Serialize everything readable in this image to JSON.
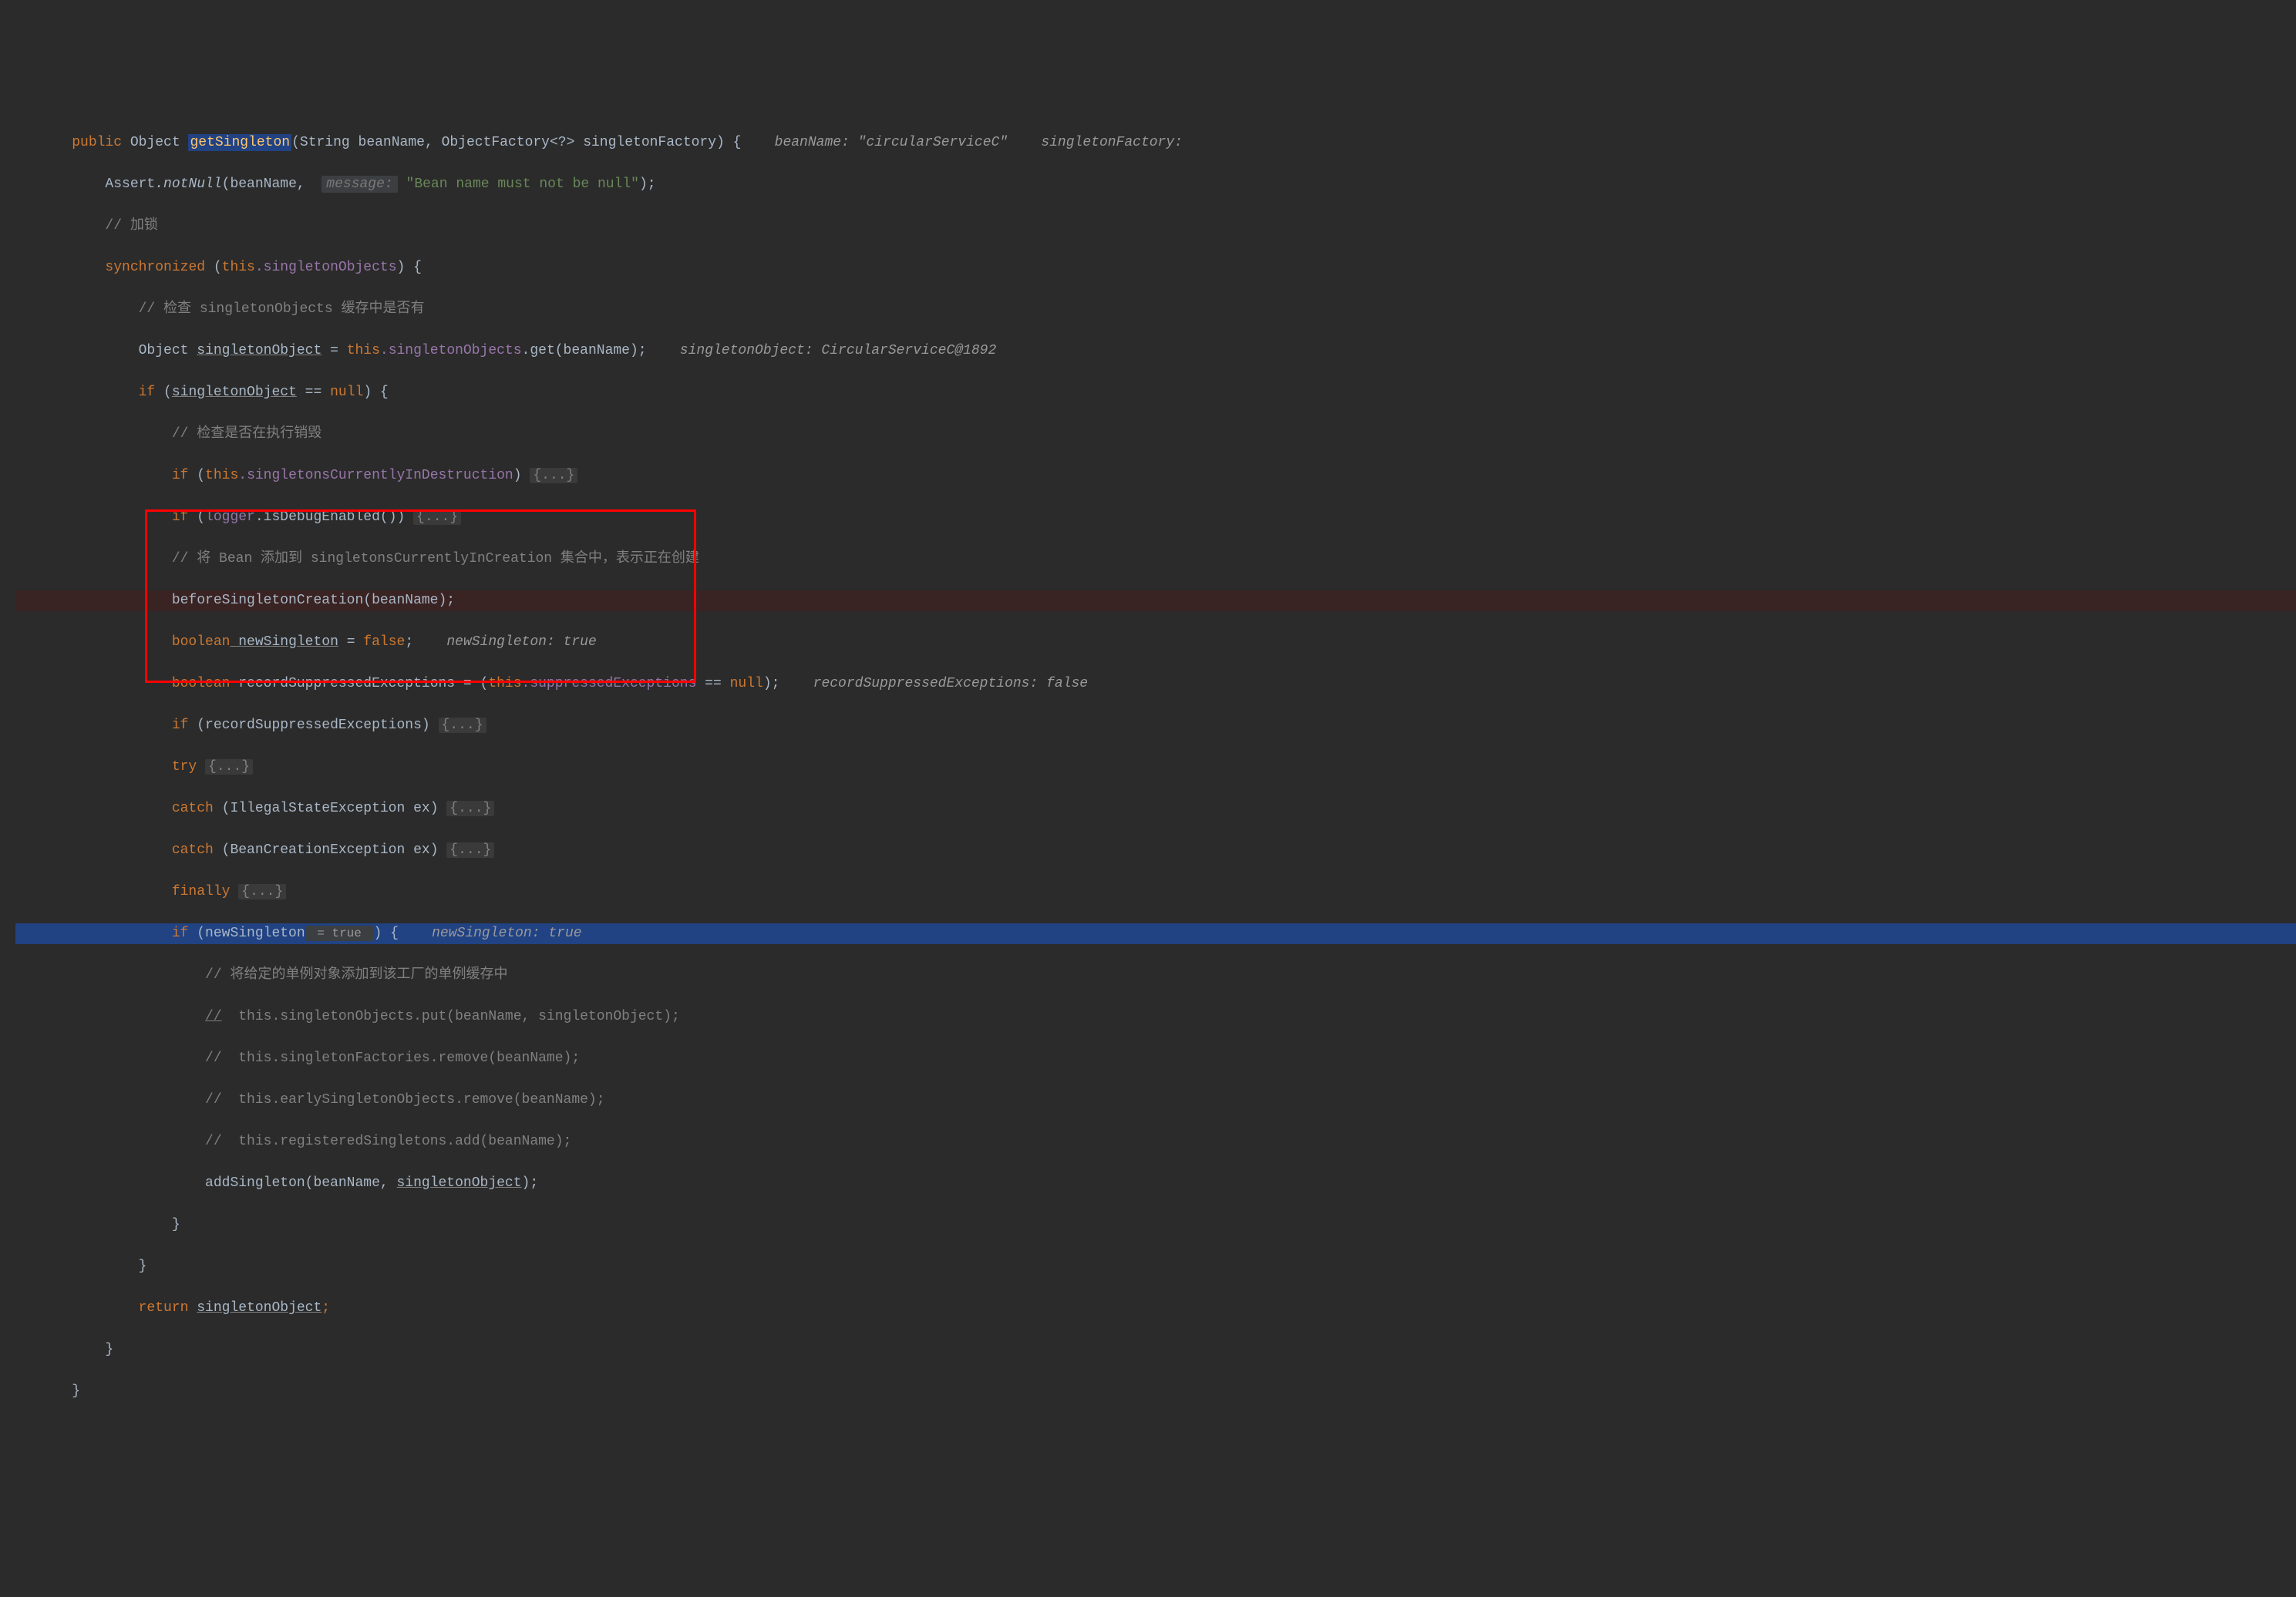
{
  "code": {
    "l1": {
      "kw_public": "public",
      "type_object": "Object",
      "method_name": "getSingleton",
      "param1_type": "String",
      "param1_name": "beanName",
      "param2_type": "ObjectFactory<?>",
      "param2_name": "singletonFactory",
      "brace": ") {",
      "hint_bean": "beanName: \"circularServiceC\"",
      "hint_factory": "singletonFactory:"
    },
    "l2": {
      "assert_cls": "Assert",
      "assert_m": ".notNull",
      "p1": "(beanName,",
      "hint_msg": "message:",
      "str_msg": "\"Bean name must not be null\"",
      "end": ");"
    },
    "l3": {
      "comment": "// 加锁"
    },
    "l4": {
      "kw_sync": "synchronized",
      "open": " (",
      "kw_this": "this",
      "field": ".singletonObjects",
      "close": ") {"
    },
    "l5": {
      "comment": "// 检查 singletonObjects 缓存中是否有"
    },
    "l6": {
      "type": "Object ",
      "var": "singletonObject",
      "eq": " = ",
      "kw_this": "this",
      "field": ".singletonObjects",
      "get": ".get(beanName);",
      "hint": "singletonObject: CircularServiceC@1892"
    },
    "l7": {
      "kw_if": "if",
      "open": " (",
      "var": "singletonObject",
      "eq": " == ",
      "kw_null": "null",
      "close": ") {"
    },
    "l8": {
      "comment": "// 检查是否在执行销毁"
    },
    "l9": {
      "kw_if": "if",
      "open": " (",
      "kw_this": "this",
      "field": ".singletonsCurrentlyInDestruction",
      "close": ") ",
      "folded": "{...}"
    },
    "l10": {
      "kw_if": "if",
      "open": " (",
      "logger": "logger",
      "call": ".isDebugEnabled()) ",
      "folded": "{...}"
    },
    "l11": {
      "comment": "// 将 Bean 添加到 singletonsCurrentlyInCreation 集合中，表示正在创建"
    },
    "l12": {
      "call": "beforeSingletonCreation(beanName);"
    },
    "l13": {
      "kw_bool": "boolean",
      "var": " newSingleton",
      "eq": " = ",
      "kw_false": "false",
      "semi": ";",
      "hint": "newSingleton: true"
    },
    "l14": {
      "kw_bool": "boolean",
      "var": " recordSuppressedExceptions = (",
      "kw_this": "this",
      "field": ".suppressedExceptions",
      "eq": " == ",
      "kw_null": "null",
      "close": ");",
      "hint": "recordSuppressedExceptions: false"
    },
    "l15": {
      "kw_if": "if",
      "var": " (recordSuppressedExceptions) ",
      "folded": "{...}"
    },
    "l16": {
      "kw_try": "try",
      "sp": " ",
      "folded": "{...}"
    },
    "l17": {
      "kw_catch": "catch",
      "open": " (IllegalStateException ex) ",
      "folded": "{...}"
    },
    "l18": {
      "kw_catch": "catch",
      "open": " (BeanCreationException ex) ",
      "folded": "{...}"
    },
    "l19": {
      "kw_finally": "finally",
      "sp": " ",
      "folded": "{...}"
    },
    "l20": {
      "kw_if": "if",
      "open": " (newSingleton",
      "inline": " = true ",
      "close": ") {",
      "hint": "newSingleton: true"
    },
    "l21": {
      "comment": "// 将给定的单例对象添加到该工厂的单例缓存中"
    },
    "l22": {
      "comment": "//  this.singletonObjects.put(beanName, singletonObject);"
    },
    "l22b": {
      "underline_part": "//"
    },
    "l23": {
      "comment": "//  this.singletonFactories.remove(beanName);"
    },
    "l24": {
      "comment": "//  this.earlySingletonObjects.remove(beanName);"
    },
    "l25": {
      "comment": "//  this.registeredSingletons.add(beanName);"
    },
    "l26": {
      "call": "addSingleton(beanName, ",
      "var": "singletonObject",
      "close": ");"
    },
    "l27": {
      "brace": "}"
    },
    "l28": {
      "brace": "}"
    },
    "l29": {
      "kw_return": "return",
      "sp": " ",
      "var": "singletonObject",
      "semi": ";"
    },
    "l30": {
      "brace": "}"
    },
    "l31": {
      "brace": "}"
    }
  }
}
